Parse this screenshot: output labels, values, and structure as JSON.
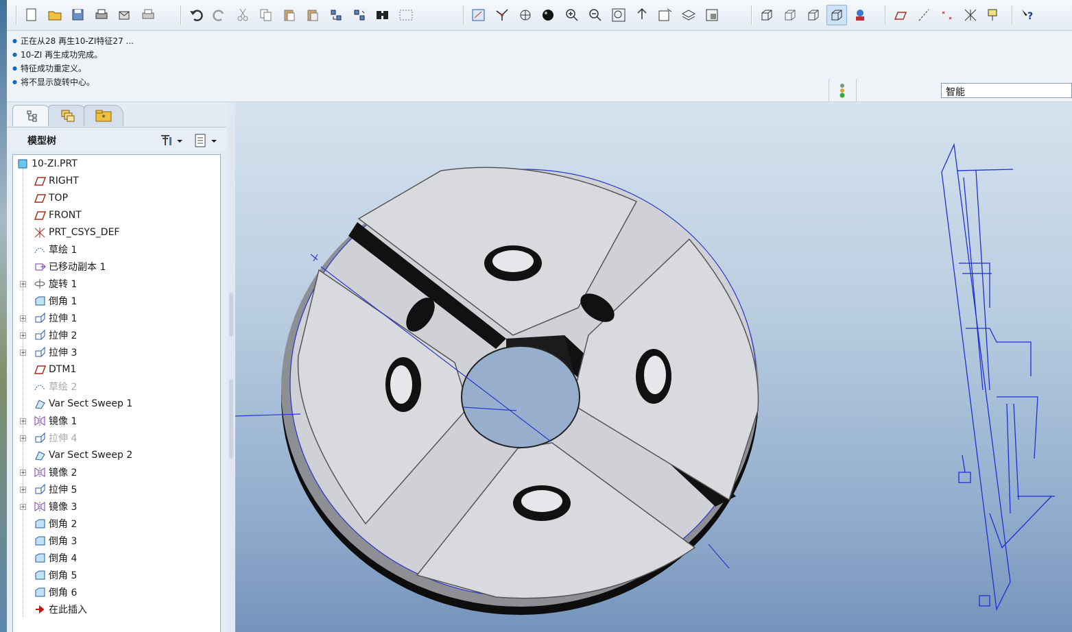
{
  "toolbar": {
    "groups": [
      [
        "new-file-icon",
        "open-folder-icon",
        "save-icon",
        "print-icon",
        "send-icon",
        "print-options-icon"
      ],
      [
        "undo-icon",
        "redo-icon",
        "cut-icon",
        "copy-icon",
        "paste-icon",
        "paste-special-icon",
        "regenerate-icon",
        "regenerate-manager-icon",
        "find-icon",
        "select-box-icon"
      ],
      [
        "sketch-view-icon",
        "datum-point-icon",
        "spin-center-icon",
        "appearance-ball-icon",
        "zoom-in-icon",
        "zoom-out-icon",
        "refit-icon",
        "orient-icon",
        "saved-views-icon",
        "layers-icon",
        "view-manager-icon"
      ],
      [
        "wireframe-icon",
        "hidden-line-icon",
        "no-hidden-icon",
        "shading-icon",
        "model-tree-display-icon"
      ],
      [
        "datum-planes-icon",
        "datum-axes-icon",
        "datum-points-icon",
        "csys-icon",
        "annotations-icon"
      ],
      [
        "context-help-icon"
      ]
    ]
  },
  "messages": [
    "正在从28 再生10-ZI特征27 ...",
    "10-ZI 再生成功完成。",
    "特征成功重定义。",
    "将不显示旋转中心。"
  ],
  "status": {
    "selection_filter": "智能"
  },
  "navigator": {
    "tabs": [
      "model-tree-tab-icon",
      "layer-tree-tab-icon",
      "favorites-tab-icon"
    ],
    "title": "模型树",
    "tree": [
      {
        "label": "10-ZI.PRT",
        "icon": "part-icon",
        "indent": 0,
        "expand": false,
        "dim": false
      },
      {
        "label": "RIGHT",
        "icon": "datum-plane-icon",
        "indent": 1,
        "expand": false,
        "dim": false
      },
      {
        "label": "TOP",
        "icon": "datum-plane-icon",
        "indent": 1,
        "expand": false,
        "dim": false
      },
      {
        "label": "FRONT",
        "icon": "datum-plane-icon",
        "indent": 1,
        "expand": false,
        "dim": false
      },
      {
        "label": "PRT_CSYS_DEF",
        "icon": "csys-icon",
        "indent": 1,
        "expand": false,
        "dim": false
      },
      {
        "label": "草绘 1",
        "icon": "sketch-icon",
        "indent": 1,
        "expand": false,
        "dim": false
      },
      {
        "label": "已移动副本 1",
        "icon": "moved-copy-icon",
        "indent": 1,
        "expand": false,
        "dim": false
      },
      {
        "label": "旋转 1",
        "icon": "revolve-icon",
        "indent": 1,
        "expand": true,
        "dim": false
      },
      {
        "label": "倒角 1",
        "icon": "chamfer-icon",
        "indent": 1,
        "expand": false,
        "dim": false
      },
      {
        "label": "拉伸 1",
        "icon": "extrude-icon",
        "indent": 1,
        "expand": true,
        "dim": false
      },
      {
        "label": "拉伸 2",
        "icon": "extrude-icon",
        "indent": 1,
        "expand": true,
        "dim": false
      },
      {
        "label": "拉伸 3",
        "icon": "extrude-icon",
        "indent": 1,
        "expand": true,
        "dim": false
      },
      {
        "label": "DTM1",
        "icon": "datum-plane-icon",
        "indent": 1,
        "expand": false,
        "dim": false
      },
      {
        "label": "草绘 2",
        "icon": "sketch-icon",
        "indent": 1,
        "expand": false,
        "dim": true
      },
      {
        "label": "Var Sect Sweep 1",
        "icon": "sweep-icon",
        "indent": 1,
        "expand": false,
        "dim": false
      },
      {
        "label": "镜像 1",
        "icon": "mirror-icon",
        "indent": 1,
        "expand": true,
        "dim": false
      },
      {
        "label": "拉伸 4",
        "icon": "extrude-icon",
        "indent": 1,
        "expand": true,
        "dim": true
      },
      {
        "label": "Var Sect Sweep 2",
        "icon": "sweep-icon",
        "indent": 1,
        "expand": false,
        "dim": false
      },
      {
        "label": "镜像 2",
        "icon": "mirror-icon",
        "indent": 1,
        "expand": true,
        "dim": false
      },
      {
        "label": "拉伸 5",
        "icon": "extrude-icon",
        "indent": 1,
        "expand": true,
        "dim": false
      },
      {
        "label": "镜像 3",
        "icon": "mirror-icon",
        "indent": 1,
        "expand": true,
        "dim": false
      },
      {
        "label": "倒角 2",
        "icon": "chamfer-icon",
        "indent": 1,
        "expand": false,
        "dim": false
      },
      {
        "label": "倒角 3",
        "icon": "chamfer-icon",
        "indent": 1,
        "expand": false,
        "dim": false
      },
      {
        "label": "倒角 4",
        "icon": "chamfer-icon",
        "indent": 1,
        "expand": false,
        "dim": false
      },
      {
        "label": "倒角 5",
        "icon": "chamfer-icon",
        "indent": 1,
        "expand": false,
        "dim": false
      },
      {
        "label": "倒角 6",
        "icon": "chamfer-icon",
        "indent": 1,
        "expand": false,
        "dim": false
      },
      {
        "label": "在此插入",
        "icon": "insert-here-icon",
        "indent": 1,
        "expand": false,
        "dim": false
      }
    ]
  },
  "colors": {
    "edge_blue": "#2233cc",
    "part_face": "#d3d4d8",
    "part_dark": "#111111",
    "msg_bullet": "#1666c5"
  }
}
